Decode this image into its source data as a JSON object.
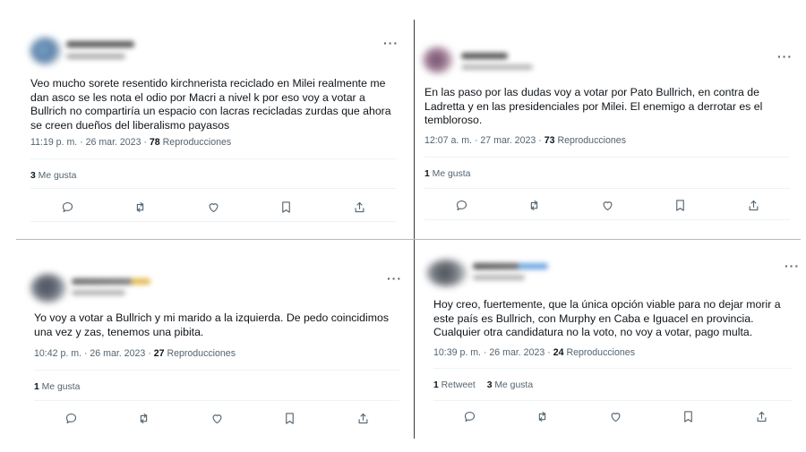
{
  "colors": {
    "text": "#0f1419",
    "secondary": "#536471",
    "separator": "#eff3f4"
  },
  "icons": [
    "reply-icon",
    "retweet-icon",
    "like-icon",
    "bookmark-icon",
    "share-icon",
    "more-icon"
  ],
  "ui": {
    "more": "···"
  },
  "tweets": [
    {
      "text": "Veo mucho sorete resentido kirchnerista reciclado en Milei realmente me dan asco se les nota el odio por Macri a nivel k por eso voy a votar a Bullrich no compartiría un espacio con lacras recicladas zurdas que ahora se creen dueños del liberalismo payasos",
      "time": "11:19 p. m. · 26 mar. 2023 ·",
      "views_count": "78",
      "views_label": "Reproducciones",
      "retweets_count": "",
      "retweets_label": "",
      "likes_count": "3",
      "likes_label": "Me gusta"
    },
    {
      "text": "En las paso por las dudas voy a votar por Pato Bullrich, en contra de Ladretta y en las presidenciales por Milei. El enemigo a derrotar es el tembloroso.",
      "time": "12:07 a. m. · 27 mar. 2023 ·",
      "views_count": "73",
      "views_label": "Reproducciones",
      "retweets_count": "",
      "retweets_label": "",
      "likes_count": "1",
      "likes_label": "Me gusta"
    },
    {
      "text": "Yo voy a votar a Bullrich y mi marido a la izquierda. De pedo coincidimos una vez y zas, tenemos una pibita.",
      "time": "10:42 p. m. · 26 mar. 2023 ·",
      "views_count": "27",
      "views_label": "Reproducciones",
      "retweets_count": "",
      "retweets_label": "",
      "likes_count": "1",
      "likes_label": "Me gusta"
    },
    {
      "text": "Hoy creo, fuertemente, que la única opción viable para no dejar morir a este país es Bullrich, con Murphy en Caba e Iguacel en provincia. Cualquier otra candidatura no la voto, no voy a votar, pago multa.",
      "time": "10:39 p. m. · 26 mar. 2023 ·",
      "views_count": "24",
      "views_label": "Reproducciones",
      "retweets_count": "1",
      "retweets_label": "Retweet",
      "likes_count": "3",
      "likes_label": "Me gusta"
    }
  ]
}
